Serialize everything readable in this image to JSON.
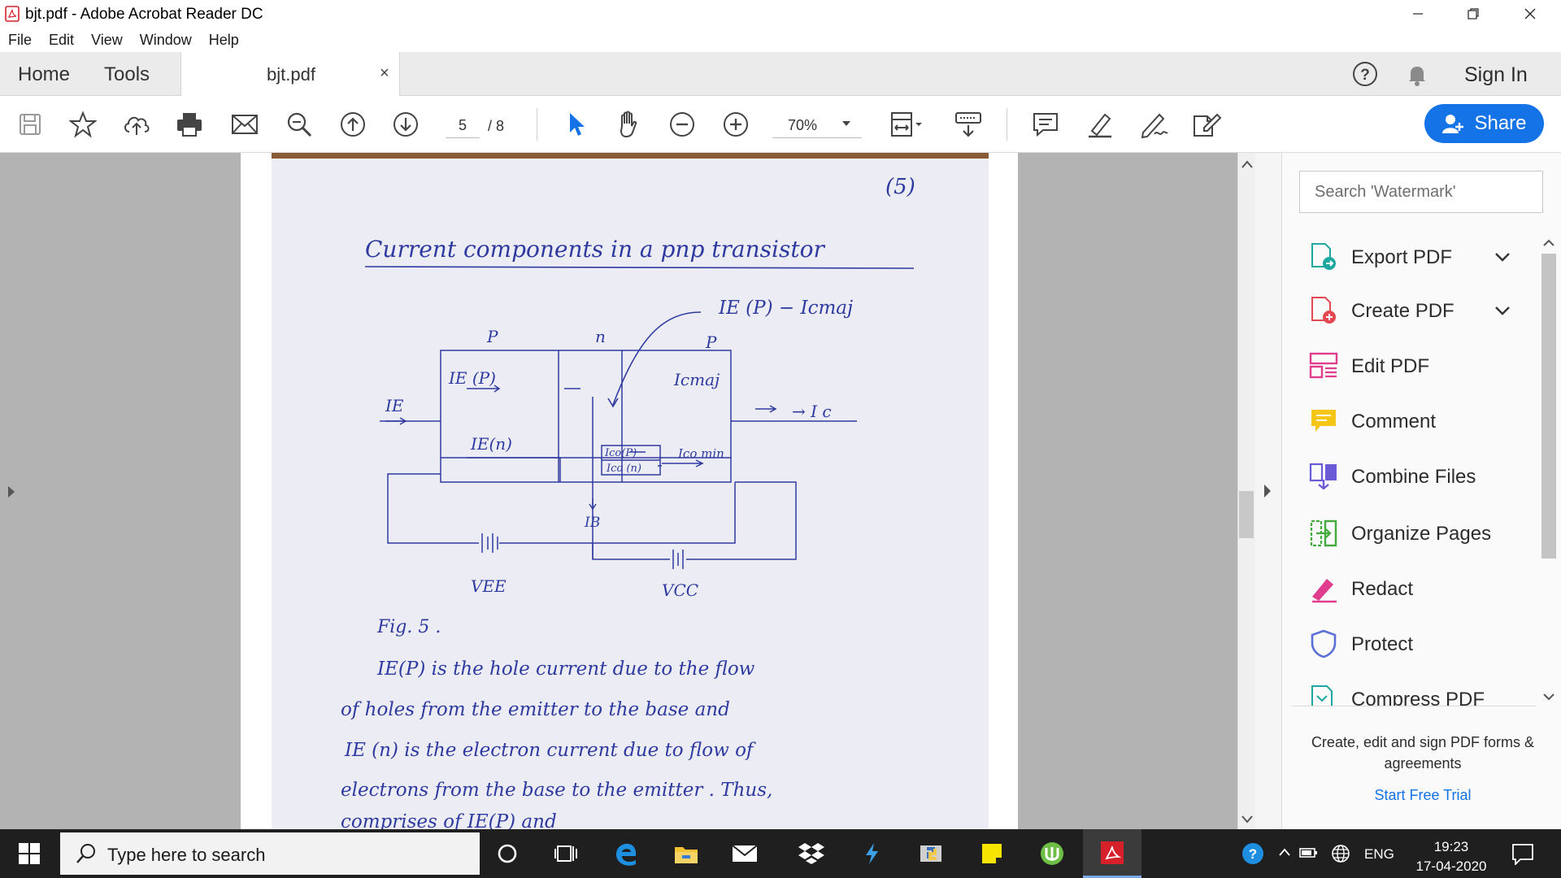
{
  "window": {
    "title": "bjt.pdf - Adobe Acrobat Reader DC",
    "controls": [
      "minimize",
      "restore",
      "close"
    ]
  },
  "menu": [
    "File",
    "Edit",
    "View",
    "Window",
    "Help"
  ],
  "tabs": {
    "home": "Home",
    "tools": "Tools",
    "document": "bjt.pdf",
    "close_glyph": "×",
    "sign_in": "Sign In"
  },
  "toolbar": {
    "page_current": "5",
    "page_total": "/ 8",
    "zoom": "70%",
    "share": "Share",
    "icons": [
      "save-icon",
      "bookmark-star-icon",
      "upload-cloud-icon",
      "print-icon",
      "email-icon",
      "zoom-search-icon",
      "page-up-icon",
      "page-down-icon",
      "select-cursor-icon",
      "hand-icon",
      "zoom-out-icon",
      "zoom-in-icon",
      "fit-page-icon",
      "read-mode-icon",
      "comment-icon",
      "highlight-icon",
      "sign-icon",
      "fill-sign-icon"
    ],
    "accent": "#1473e6"
  },
  "document": {
    "page_number": "(5)",
    "heading": "Current  components  in  a  pnp  transistor",
    "labels": {
      "ie_p_icmaj": "IE (P) − Icmaj",
      "p_left": "P",
      "n_mid": "n",
      "p_right": "P",
      "ie_p": "IE (P)",
      "ic_maj": "Icmaj",
      "ie": "IE",
      "ic": "→ I c",
      "ie_n": "IE(n)",
      "ico_p": "Ico(P)",
      "ico_n": "Ico (n)",
      "ico_min": "Ico min",
      "ib": "IB",
      "vee": "VEE",
      "vcc": "VCC"
    },
    "figure": "Fig. 5 .",
    "body_lines": [
      "IE(P)   is  the   hole  current  due  to  the  flow",
      "of  holes  from  the  emitter  to  the  base  and",
      "IE (n)   is   the   electron  current  due  to  flow  of",
      "electrons  from  the   base   to  the  emitter .  Thus,",
      "               comprises   of  IE(P)  and"
    ]
  },
  "right_pane": {
    "search_placeholder": "Search 'Watermark'",
    "tools": [
      {
        "label": "Export PDF",
        "icon": "export-pdf-icon",
        "color": "#1ea7a0"
      },
      {
        "label": "Create PDF",
        "icon": "create-pdf-icon",
        "color": "#e34850"
      },
      {
        "label": "Edit PDF",
        "icon": "edit-pdf-icon",
        "color": "#e03d8f"
      },
      {
        "label": "Comment",
        "icon": "comment-tool-icon",
        "color": "#f5c518"
      },
      {
        "label": "Combine Files",
        "icon": "combine-files-icon",
        "color": "#6a5cd7"
      },
      {
        "label": "Organize Pages",
        "icon": "organize-pages-icon",
        "color": "#42a93a"
      },
      {
        "label": "Redact",
        "icon": "redact-icon",
        "color": "#e03d8f"
      },
      {
        "label": "Protect",
        "icon": "protect-icon",
        "color": "#5b6fd6"
      },
      {
        "label": "Compress PDF",
        "icon": "compress-pdf-icon",
        "color": "#1ea7a0"
      }
    ],
    "promo": "Create, edit and sign PDF forms & agreements",
    "trial": "Start Free Trial"
  },
  "taskbar": {
    "search_placeholder": "Type here to search",
    "apps": [
      "cortana-icon",
      "task-view-icon",
      "edge-icon",
      "file-explorer-icon",
      "mail-icon",
      "dropbox-icon",
      "visual-studio-icon",
      "python-icon",
      "sticky-notes-icon",
      "utorrent-icon",
      "acrobat-icon"
    ],
    "language": "ENG",
    "time": "19:23",
    "date": "17-04-2020"
  }
}
